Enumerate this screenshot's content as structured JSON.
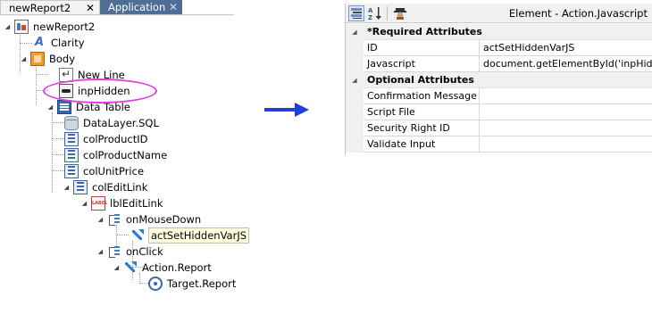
{
  "tabs": [
    {
      "label": "newReport2",
      "active": true
    },
    {
      "label": "Application",
      "active": false
    }
  ],
  "tree": {
    "nodes": [
      {
        "label": "newReport2",
        "icon": "report-icon",
        "expanded": true
      },
      {
        "label": "Clarity",
        "icon": "style-icon"
      },
      {
        "label": "Body",
        "icon": "body-icon",
        "expanded": true
      },
      {
        "label": "New Line",
        "icon": "new-line-icon"
      },
      {
        "label": "inpHidden",
        "icon": "hidden-input-icon"
      },
      {
        "label": "Data Table",
        "icon": "data-table-icon",
        "expanded": true
      },
      {
        "label": "DataLayer.SQL",
        "icon": "datalayer-icon"
      },
      {
        "label": "colProductID",
        "icon": "column-icon"
      },
      {
        "label": "colProductName",
        "icon": "column-icon"
      },
      {
        "label": "colUnitPrice",
        "icon": "column-icon"
      },
      {
        "label": "colEditLink",
        "icon": "column-icon",
        "expanded": true
      },
      {
        "label": "lblEditLink",
        "icon": "label-icon",
        "expanded": true
      },
      {
        "label": "onMouseDown",
        "icon": "event-handler-icon",
        "expanded": true
      },
      {
        "label": "actSetHiddenVarJS",
        "icon": "action-icon",
        "selected": true
      },
      {
        "label": "onClick",
        "icon": "event-handler-icon",
        "expanded": true
      },
      {
        "label": "Action.Report",
        "icon": "action-icon",
        "expanded": true
      },
      {
        "label": "Target.Report",
        "icon": "target-icon"
      }
    ],
    "label_badge_text": "LABEL"
  },
  "properties": {
    "title": "Element - Action.Javascript",
    "toolbar": {
      "categorized_icon": "categorized-view-icon",
      "alphabetical_icon": "alphabetical-sort-icon",
      "pages_icon": "property-pages-icon"
    },
    "categories": [
      {
        "name": "*Required Attributes",
        "rows": [
          {
            "name": "ID",
            "value": "actSetHiddenVarJS"
          },
          {
            "name": "Javascript",
            "value": "document.getElementById('inpHidde"
          }
        ]
      },
      {
        "name": "Optional Attributes",
        "rows": [
          {
            "name": "Confirmation Message",
            "value": ""
          },
          {
            "name": "Script File",
            "value": ""
          },
          {
            "name": "Security Right ID",
            "value": ""
          },
          {
            "name": "Validate Input",
            "value": ""
          }
        ]
      }
    ]
  },
  "colors": {
    "arrow": "#1f3fd6",
    "highlight_ellipse": "#e040e0",
    "inactive_tab": "#4f6e96"
  }
}
